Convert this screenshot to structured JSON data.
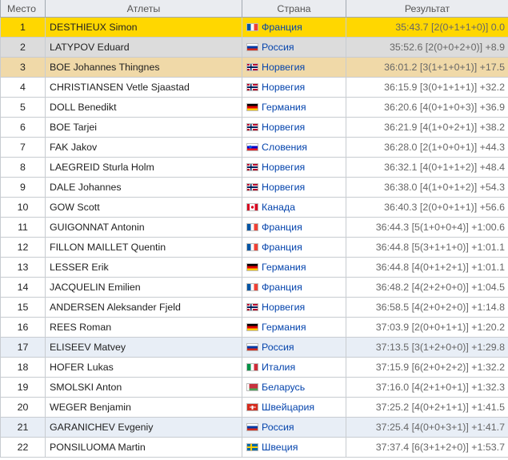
{
  "headers": {
    "place": "Место",
    "athletes": "Атлеты",
    "country": "Страна",
    "result": "Результат"
  },
  "rows": [
    {
      "place": "1",
      "name": "DESTHIEUX Simon",
      "flag": "FRA",
      "country": "Франция",
      "result": "35:43.7 [2(0+1+1+0)] 0.0",
      "style": "gold"
    },
    {
      "place": "2",
      "name": "LATYPOV Eduard",
      "flag": "RUS",
      "country": "Россия",
      "result": "35:52.6 [2(0+0+2+0)] +8.9",
      "style": "silver"
    },
    {
      "place": "3",
      "name": "BOE Johannes Thingnes",
      "flag": "NOR",
      "country": "Норвегия",
      "result": "36:01.2 [3(1+1+0+1)] +17.5",
      "style": "bronze"
    },
    {
      "place": "4",
      "name": "CHRISTIANSEN Vetle Sjaastad",
      "flag": "NOR",
      "country": "Норвегия",
      "result": "36:15.9 [3(0+1+1+1)] +32.2",
      "style": ""
    },
    {
      "place": "5",
      "name": "DOLL Benedikt",
      "flag": "GER",
      "country": "Германия",
      "result": "36:20.6 [4(0+1+0+3)] +36.9",
      "style": ""
    },
    {
      "place": "6",
      "name": "BOE Tarjei",
      "flag": "NOR",
      "country": "Норвегия",
      "result": "36:21.9 [4(1+0+2+1)] +38.2",
      "style": ""
    },
    {
      "place": "7",
      "name": "FAK Jakov",
      "flag": "SLO",
      "country": "Словения",
      "result": "36:28.0 [2(1+0+0+1)] +44.3",
      "style": ""
    },
    {
      "place": "8",
      "name": "LAEGREID Sturla Holm",
      "flag": "NOR",
      "country": "Норвегия",
      "result": "36:32.1 [4(0+1+1+2)] +48.4",
      "style": ""
    },
    {
      "place": "9",
      "name": "DALE Johannes",
      "flag": "NOR",
      "country": "Норвегия",
      "result": "36:38.0 [4(1+0+1+2)] +54.3",
      "style": ""
    },
    {
      "place": "10",
      "name": "GOW Scott",
      "flag": "CAN",
      "country": "Канада",
      "result": "36:40.3 [2(0+0+1+1)] +56.6",
      "style": ""
    },
    {
      "place": "11",
      "name": "GUIGONNAT Antonin",
      "flag": "FRA",
      "country": "Франция",
      "result": "36:44.3 [5(1+0+0+4)] +1:00.6",
      "style": ""
    },
    {
      "place": "12",
      "name": "FILLON MAILLET Quentin",
      "flag": "FRA",
      "country": "Франция",
      "result": "36:44.8 [5(3+1+1+0)] +1:01.1",
      "style": ""
    },
    {
      "place": "13",
      "name": "LESSER Erik",
      "flag": "GER",
      "country": "Германия",
      "result": "36:44.8 [4(0+1+2+1)] +1:01.1",
      "style": ""
    },
    {
      "place": "14",
      "name": "JACQUELIN Emilien",
      "flag": "FRA",
      "country": "Франция",
      "result": "36:48.2 [4(2+2+0+0)] +1:04.5",
      "style": ""
    },
    {
      "place": "15",
      "name": "ANDERSEN Aleksander Fjeld",
      "flag": "NOR",
      "country": "Норвегия",
      "result": "36:58.5 [4(2+0+2+0)] +1:14.8",
      "style": ""
    },
    {
      "place": "16",
      "name": "REES Roman",
      "flag": "GER",
      "country": "Германия",
      "result": "37:03.9 [2(0+0+1+1)] +1:20.2",
      "style": ""
    },
    {
      "place": "17",
      "name": "ELISEEV Matvey",
      "flag": "RUS",
      "country": "Россия",
      "result": "37:13.5 [3(1+2+0+0)] +1:29.8",
      "style": "hl"
    },
    {
      "place": "18",
      "name": "HOFER Lukas",
      "flag": "ITA",
      "country": "Италия",
      "result": "37:15.9 [6(2+0+2+2)] +1:32.2",
      "style": ""
    },
    {
      "place": "19",
      "name": "SMOLSKI Anton",
      "flag": "BLR",
      "country": "Беларусь",
      "result": "37:16.0 [4(2+1+0+1)] +1:32.3",
      "style": ""
    },
    {
      "place": "20",
      "name": "WEGER Benjamin",
      "flag": "SUI",
      "country": "Швейцария",
      "result": "37:25.2 [4(0+2+1+1)] +1:41.5",
      "style": ""
    },
    {
      "place": "21",
      "name": "GARANICHEV Evgeniy",
      "flag": "RUS",
      "country": "Россия",
      "result": "37:25.4 [4(0+0+3+1)] +1:41.7",
      "style": "hl"
    },
    {
      "place": "22",
      "name": "PONSILUOMA Martin",
      "flag": "SWE",
      "country": "Швеция",
      "result": "37:37.4 [6(3+1+2+0)] +1:53.7",
      "style": ""
    }
  ]
}
